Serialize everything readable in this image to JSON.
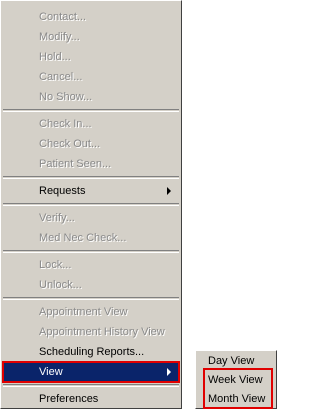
{
  "context_menu": {
    "groups": [
      [
        {
          "label": "Contact...",
          "enabled": false
        },
        {
          "label": "Modify...",
          "enabled": false
        },
        {
          "label": "Hold...",
          "enabled": false
        },
        {
          "label": "Cancel...",
          "enabled": false
        },
        {
          "label": "No Show...",
          "enabled": false
        }
      ],
      [
        {
          "label": "Check In...",
          "enabled": false
        },
        {
          "label": "Check Out...",
          "enabled": false
        },
        {
          "label": "Patient Seen...",
          "enabled": false
        }
      ],
      [
        {
          "label": "Requests",
          "enabled": true,
          "submenu": true
        }
      ],
      [
        {
          "label": "Verify...",
          "enabled": false
        },
        {
          "label": "Med Nec Check...",
          "enabled": false
        }
      ],
      [
        {
          "label": "Lock...",
          "enabled": false
        },
        {
          "label": "Unlock...",
          "enabled": false
        }
      ],
      [
        {
          "label": "Appointment View",
          "enabled": false
        },
        {
          "label": "Appointment History View",
          "enabled": false
        },
        {
          "label": "Scheduling Reports...",
          "enabled": true
        },
        {
          "label": "View",
          "enabled": true,
          "submenu": true,
          "selected": true
        }
      ],
      [
        {
          "label": "Preferences",
          "enabled": true
        }
      ]
    ]
  },
  "view_submenu": {
    "items": [
      "Day View",
      "Week View",
      "Month View"
    ]
  },
  "colors": {
    "menu_bg": "#d4d0c8",
    "selection": "#0a246a",
    "highlight_box": "#e00000"
  }
}
